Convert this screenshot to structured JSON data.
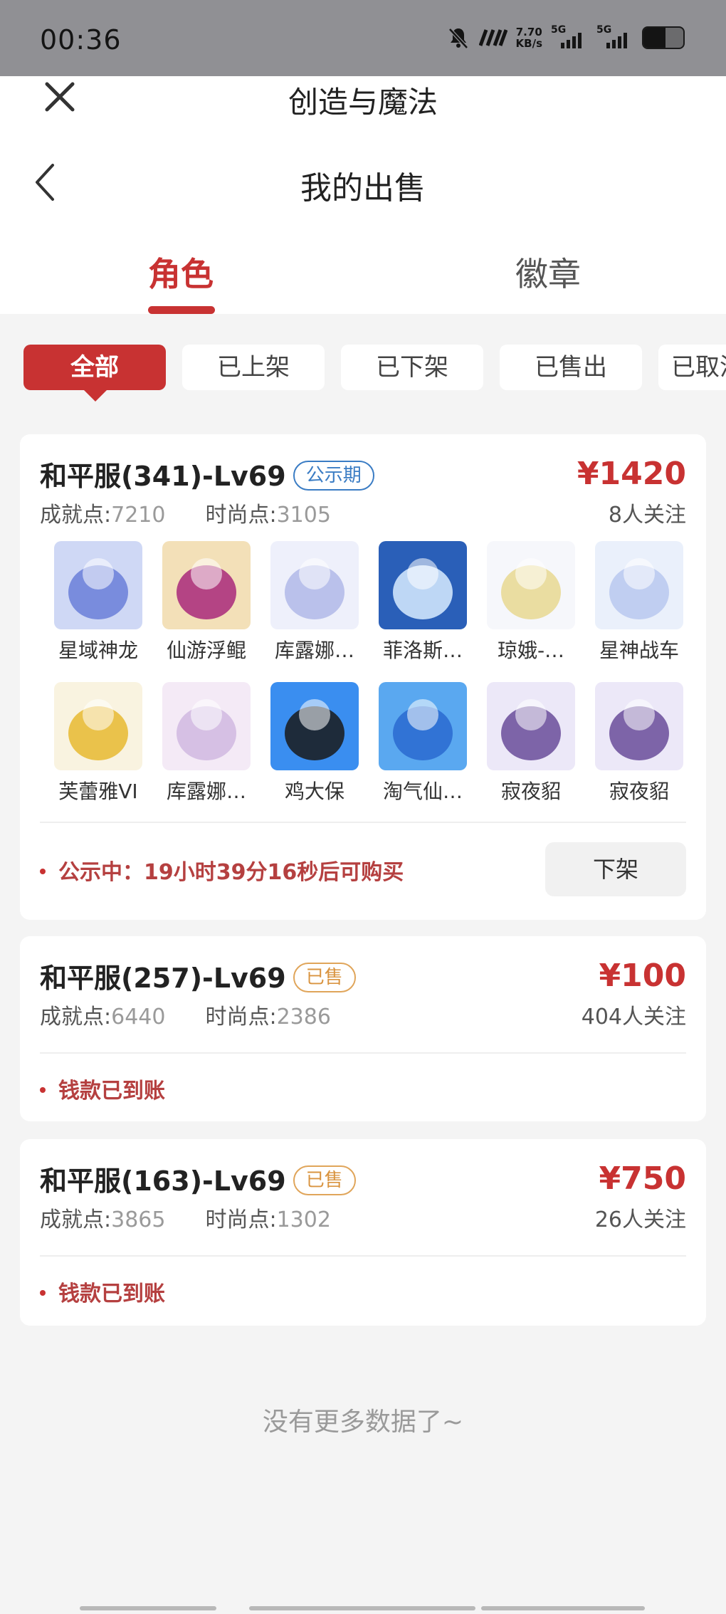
{
  "status_bar": {
    "time": "00:36",
    "net_speed_value": "7.70",
    "net_speed_unit": "KB/s",
    "signal1_label": "5G",
    "signal2_label": "5G",
    "battery_level": 0.55
  },
  "header": {
    "app_title": "创造与魔法",
    "page_title": "我的出售"
  },
  "tabs": [
    {
      "label": "角色",
      "active": true
    },
    {
      "label": "徽章",
      "active": false
    }
  ],
  "filters": [
    {
      "label": "全部",
      "active": true
    },
    {
      "label": "已上架",
      "active": false
    },
    {
      "label": "已下架",
      "active": false
    },
    {
      "label": "已售出",
      "active": false
    },
    {
      "label": "已取消",
      "active": false
    }
  ],
  "listings": [
    {
      "name": "和平服(341)-Lv69",
      "badge": "公示期",
      "achievement_label": "成就点:",
      "achievement_value": "7210",
      "fashion_label": "时尚点:",
      "fashion_value": "3105",
      "price": "¥1420",
      "followers": "8人关注",
      "items": [
        "星域神龙",
        "仙游浮鲲",
        "库露娜…",
        "菲洛斯…",
        "琼娥-…",
        "星神战车",
        "芙蕾雅VI",
        "库露娜…",
        "鸡大保",
        "淘气仙…",
        "寂夜貂",
        "寂夜貂"
      ],
      "note": "公示中：19小时39分16秒后可购买",
      "action_button": "下架"
    },
    {
      "name": "和平服(257)-Lv69",
      "badge": "已售",
      "achievement_label": "成就点:",
      "achievement_value": "6440",
      "fashion_label": "时尚点:",
      "fashion_value": "2386",
      "price": "¥100",
      "followers": "404人关注",
      "note": "钱款已到账"
    },
    {
      "name": "和平服(163)-Lv69",
      "badge": "已售",
      "achievement_label": "成就点:",
      "achievement_value": "3865",
      "fashion_label": "时尚点:",
      "fashion_value": "1302",
      "price": "¥750",
      "followers": "26人关注",
      "note": "钱款已到账"
    }
  ],
  "footer": {
    "no_more": "没有更多数据了~"
  },
  "colors": {
    "accent": "#c83232",
    "status_bar": "#909094",
    "badge_blue": "#3a7cc4",
    "badge_orange": "#d99440"
  },
  "item_icons": [
    "dragon-icon",
    "golden-whale-icon",
    "white-hair-girl-icon",
    "ice-warrior-icon",
    "fairy-icon",
    "white-horse-icon",
    "golden-angel-icon",
    "pink-girl-icon",
    "blue-bird-icon",
    "blue-dog-icon",
    "purple-fox-icon",
    "purple-fox-icon"
  ]
}
